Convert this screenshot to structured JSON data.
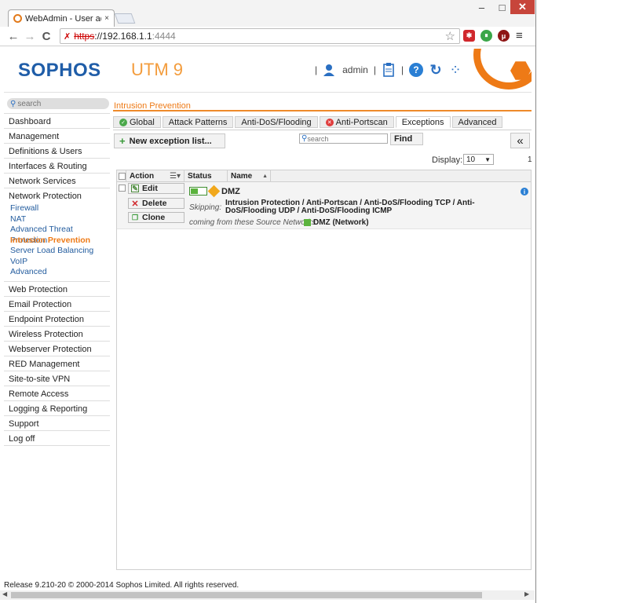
{
  "browser": {
    "tab_title": "WebAdmin - User admin",
    "tab_close": "×",
    "win_min": "–",
    "win_max": "□",
    "win_close": "✕",
    "back": "←",
    "forward": "→",
    "reload": "C",
    "url_proto": "https",
    "url_sep": "://",
    "url_host": "192.168.1.1",
    "url_port": ":4444",
    "star": "☆",
    "menu": "≡",
    "extensions": [
      {
        "glyph": "✱",
        "color": "#d0272c"
      },
      {
        "glyph": "⏸",
        "color": "#3aa648"
      },
      {
        "glyph": "μ",
        "color": "#8e1414"
      }
    ]
  },
  "header": {
    "logo": "SOPHOS",
    "product": "UTM 9",
    "sep1": "|",
    "user": "admin",
    "sep2": "|",
    "sep3": "|",
    "help": "?",
    "reload": "↻",
    "activity": "⁘"
  },
  "sidebar": {
    "search_placeholder": "search",
    "items_top": [
      "Dashboard",
      "Management",
      "Definitions & Users",
      "Interfaces & Routing",
      "Network Services"
    ],
    "open_section": "Network Protection",
    "sub_items": [
      "Firewall",
      "NAT",
      "Advanced Threat Protection",
      "Intrusion Prevention",
      "Server Load Balancing",
      "VoIP",
      "Advanced"
    ],
    "active_sub": "Intrusion Prevention",
    "items_bottom": [
      "Web Protection",
      "Email Protection",
      "Endpoint Protection",
      "Wireless Protection",
      "Webserver Protection",
      "RED Management",
      "Site-to-site VPN",
      "Remote Access",
      "Logging & Reporting",
      "Support",
      "Log off"
    ]
  },
  "main": {
    "breadcrumb": "Intrusion Prevention",
    "tabs": [
      {
        "label": "Global",
        "status": "ok"
      },
      {
        "label": "Attack Patterns",
        "status": ""
      },
      {
        "label": "Anti-DoS/Flooding",
        "status": ""
      },
      {
        "label": "Anti-Portscan",
        "status": "err"
      },
      {
        "label": "Exceptions",
        "status": "",
        "active": true
      },
      {
        "label": "Advanced",
        "status": ""
      }
    ],
    "new_button": "New exception list...",
    "search_placeholder": "search",
    "find_button": "Find",
    "collapse": "«",
    "display_label": "Display:",
    "display_value": "10",
    "page_no": "1",
    "table": {
      "headers": [
        "Action",
        "Status",
        "Name"
      ],
      "row": {
        "edit": "Edit",
        "delete": "Delete",
        "clone": "Clone",
        "name": "DMZ",
        "skip_label": "Skipping:",
        "skip_value": "Intrusion Protection / Anti-Portscan / Anti-DoS/Flooding TCP / Anti-DoS/Flooding UDP / Anti-DoS/Flooding ICMP",
        "from_label": "coming from these Source Networks:",
        "network": "DMZ (Network)",
        "info": "i"
      }
    }
  },
  "status_bar": "Release 9.210-20 © 2000-2014 Sophos Limited. All rights reserved.",
  "colors": {
    "accent": "#ee7a16",
    "brand": "#1f5da8",
    "link": "#235c9e"
  }
}
